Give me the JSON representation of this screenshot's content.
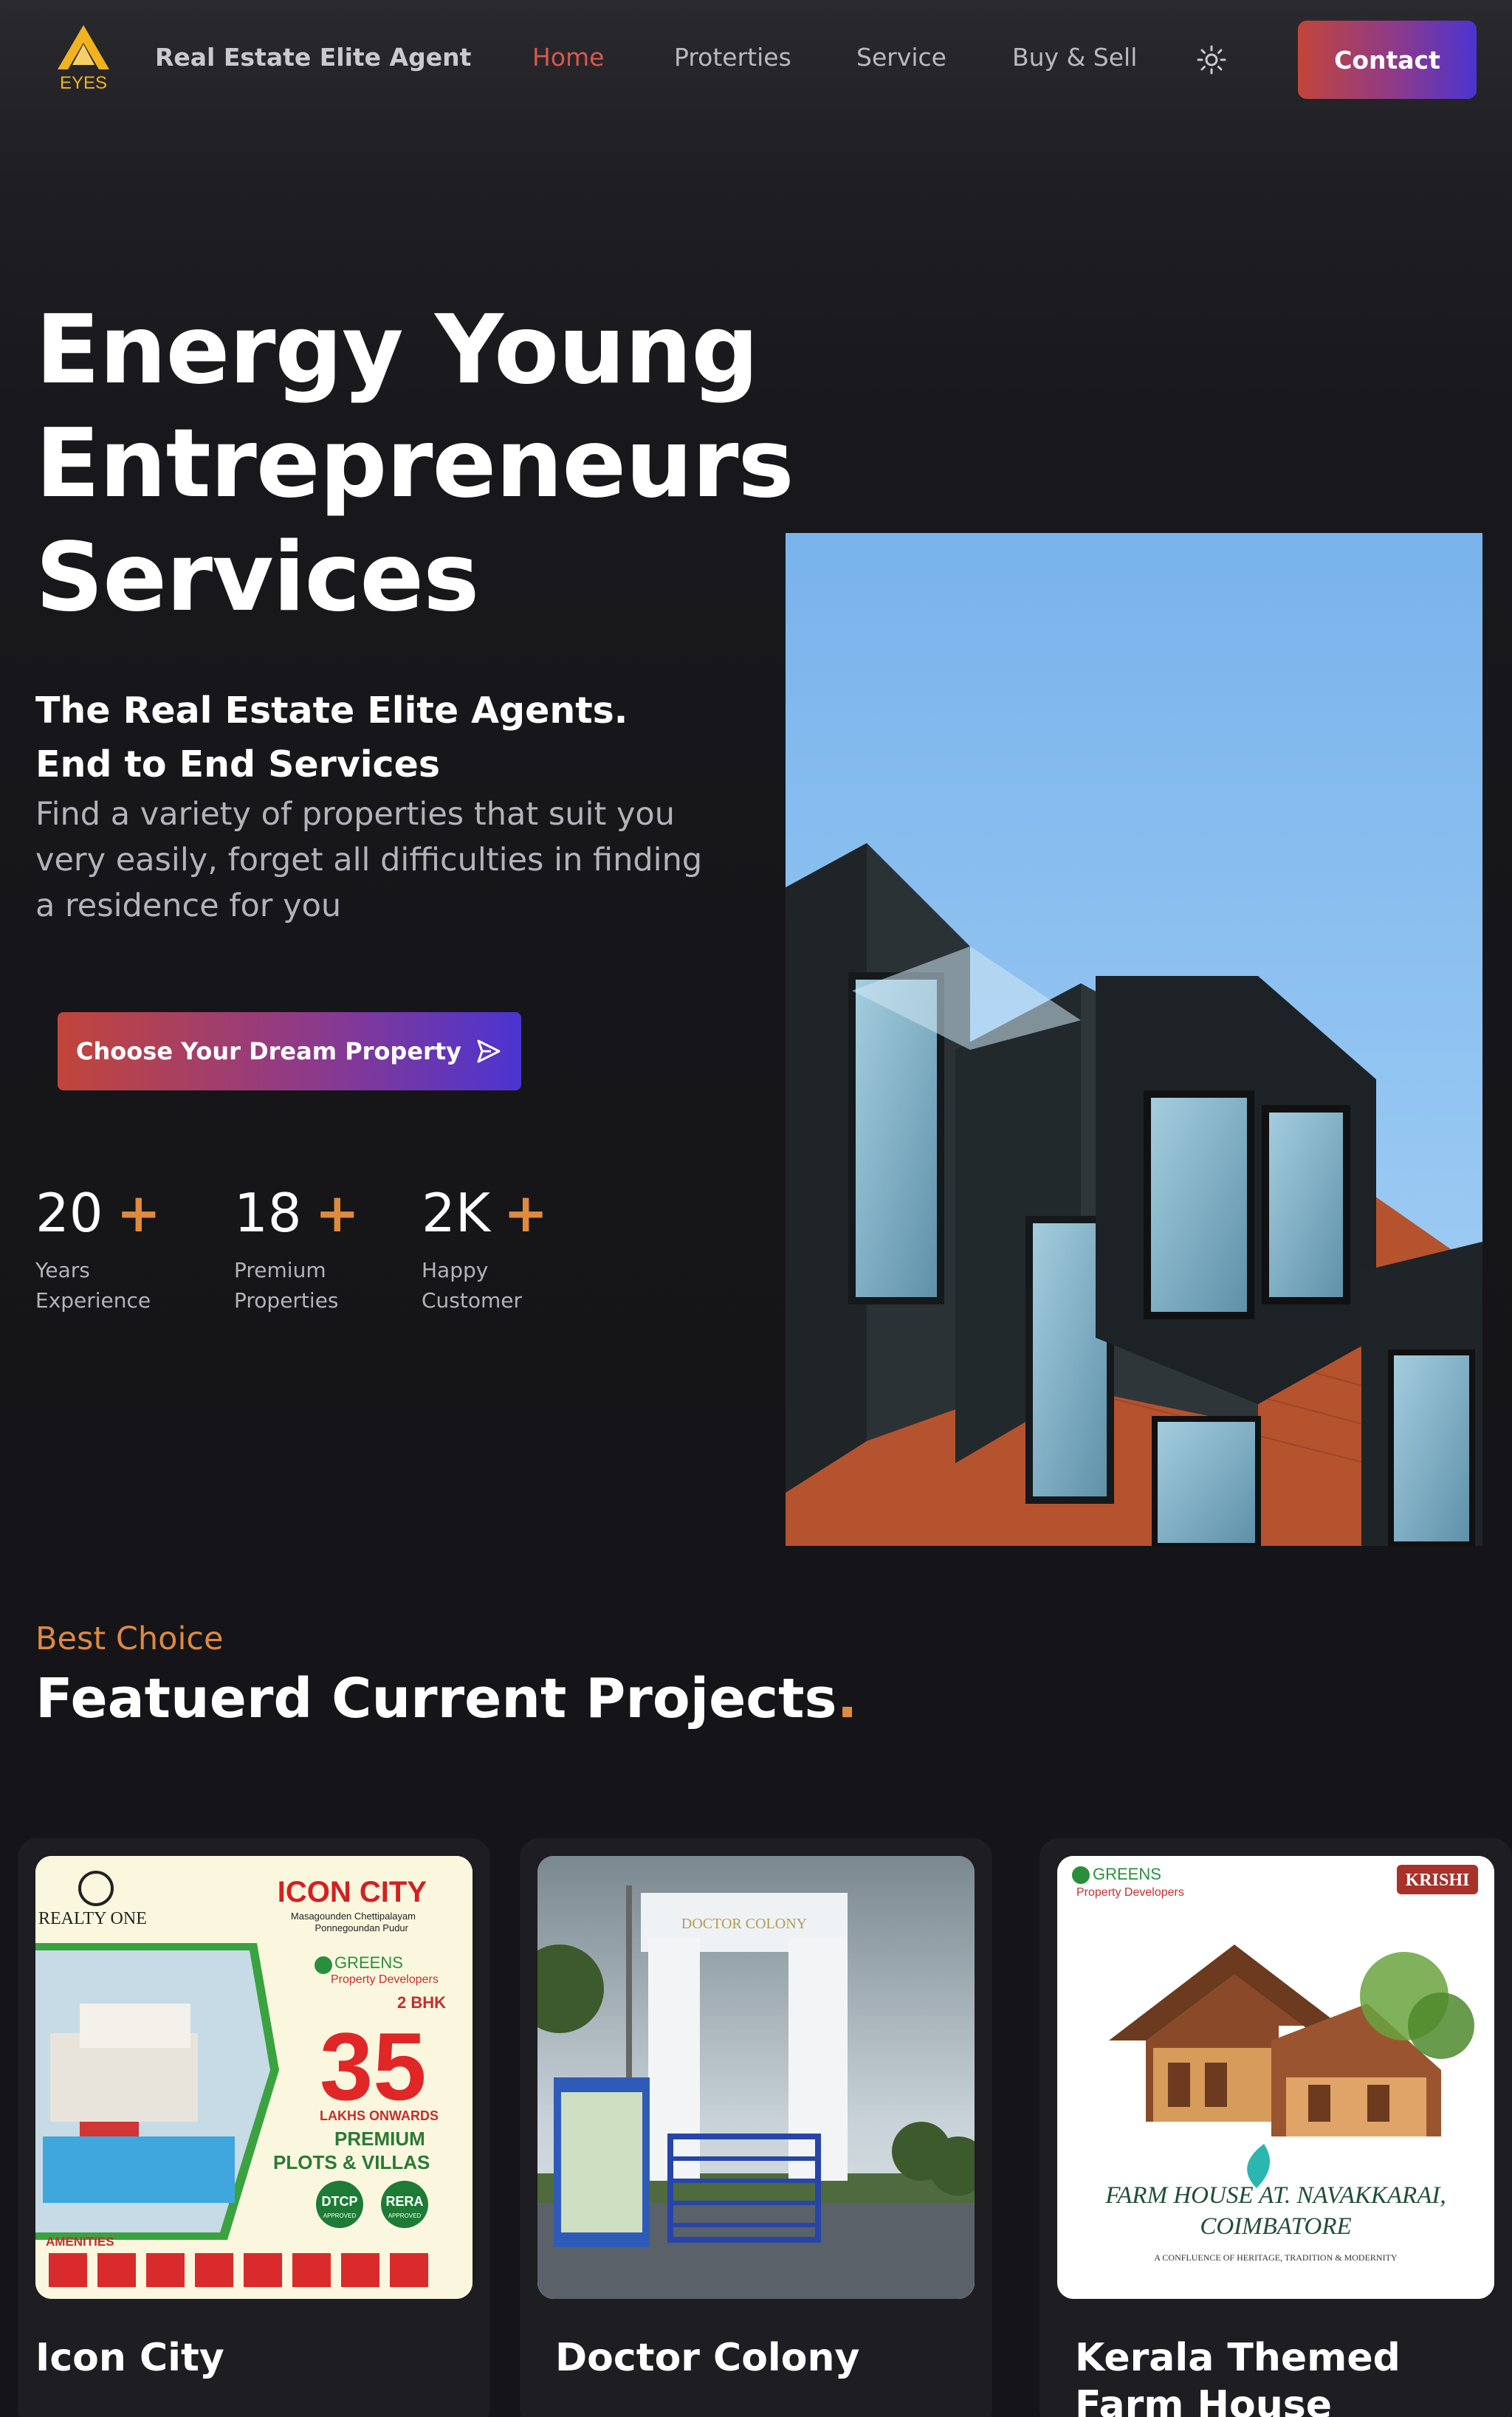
{
  "nav": {
    "brand": "Real Estate Elite Agent",
    "logo_text": "EYES",
    "links": [
      {
        "label": "Home",
        "active": true
      },
      {
        "label": "Proterties",
        "active": false
      },
      {
        "label": "Service",
        "active": false
      },
      {
        "label": "Buy & Sell",
        "active": false
      }
    ],
    "theme_icon": "sun-icon",
    "contact_label": "Contact"
  },
  "hero": {
    "title_lines": [
      "Energy Young",
      "Entrepreneurs",
      "Services"
    ],
    "subtitle_lines": [
      "The Real Estate Elite Agents.",
      "End to End Services"
    ],
    "description": "Find a variety of properties that suit you very easily, forget all difficulties in finding a residence for you",
    "cta_label": "Choose Your Dream Property",
    "cta_icon": "send-icon",
    "stats": [
      {
        "value": "20",
        "suffix": "+",
        "label_lines": [
          "Years",
          "Experience"
        ]
      },
      {
        "value": "18",
        "suffix": "+",
        "label_lines": [
          "Premium",
          "Properties"
        ]
      },
      {
        "value": "2K",
        "suffix": "+",
        "label_lines": [
          "Happy",
          "Customer"
        ]
      }
    ]
  },
  "featured": {
    "eyebrow": "Best Choice",
    "title": "Featuerd Current Projects",
    "title_dot": ".",
    "projects": [
      {
        "title": "Icon City",
        "image": {
          "brand": "REALTY ONE",
          "headline": "ICON CITY",
          "address_lines": [
            "Masagounden Chettipalayam",
            "Ponnegoundan Pudur"
          ],
          "developer": "GREENS",
          "developer_sub": "Property Developers",
          "bhk": "2 BHK",
          "price": "35",
          "price_note": "LAKHS ONWARDS",
          "offer_lines": [
            "PREMIUM",
            "PLOTS & VILLAS"
          ],
          "badges": [
            "DTCP",
            "RERA"
          ],
          "badge_note": "APPROVED",
          "amenities_label": "AMENITIES"
        }
      },
      {
        "title": "Doctor Colony",
        "image": {
          "arch_text": "DOCTOR COLONY"
        }
      },
      {
        "title": "Kerala Themed Farm House",
        "image": {
          "developer": "GREENS",
          "developer_sub": "Property Developers",
          "tag": "KRISHI",
          "headline_lines": [
            "FARM HOUSE AT. NAVAKKARAI,",
            "COIMBATORE"
          ],
          "tagline": "A CONFLUENCE OF HERITAGE, TRADITION & MODERNITY"
        }
      }
    ]
  },
  "colors": {
    "accent_orange": "#e08a3c",
    "active_nav": "#d9574c",
    "gradient_start": "#c2453a",
    "gradient_end": "#4b34d1",
    "background": "#141418"
  }
}
